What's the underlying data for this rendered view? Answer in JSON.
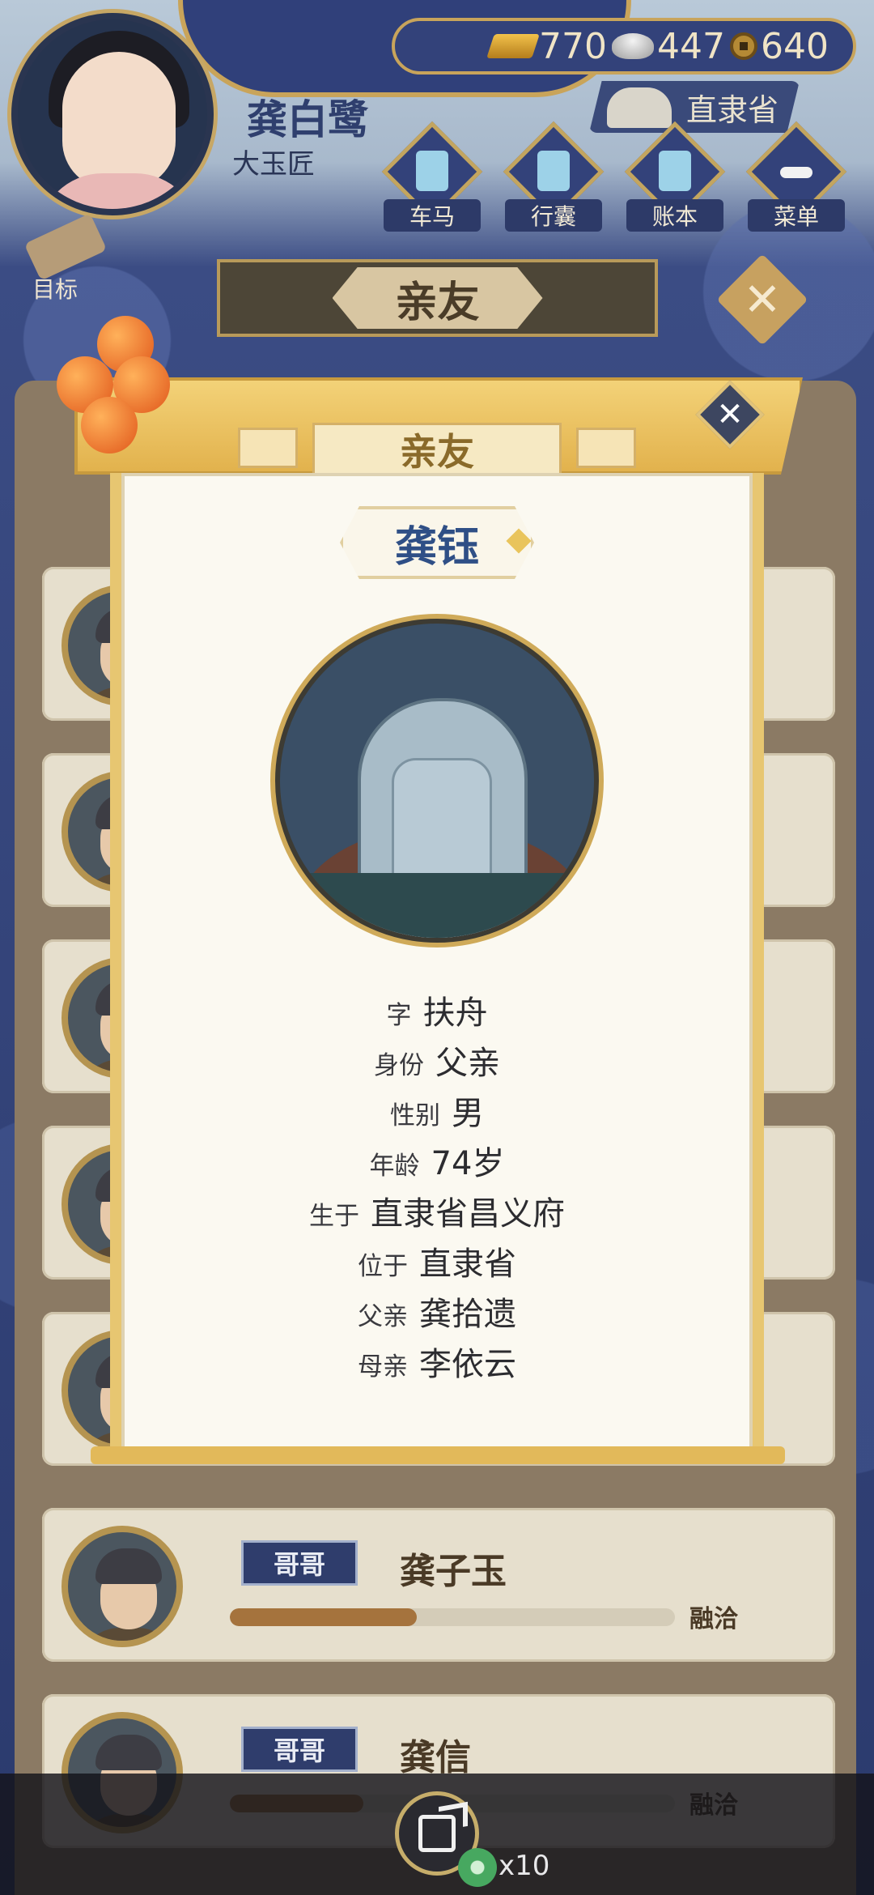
{
  "player": {
    "name": "龚白鹭",
    "title": "大玉匠"
  },
  "currency": {
    "gold": "770",
    "silver": "447",
    "coins": "640"
  },
  "location": "直隶省",
  "menu": [
    {
      "label": "车马",
      "icon": "carriage-icon"
    },
    {
      "label": "行囊",
      "icon": "bag-icon"
    },
    {
      "label": "账本",
      "icon": "ledger-icon"
    },
    {
      "label": "菜单",
      "icon": "menu-dots-icon"
    }
  ],
  "goal_label": "目标",
  "section_title": "亲友",
  "relatives": [
    {
      "relation": "哥哥",
      "name": "龚子玉",
      "affinity_label": "融洽",
      "affinity": 0.42
    },
    {
      "relation": "哥哥",
      "name": "龚信",
      "affinity_label": "融洽",
      "affinity": 0.3
    }
  ],
  "modal": {
    "title": "亲友",
    "person_name": "龚钰",
    "details": [
      {
        "key": "字",
        "value": "扶舟"
      },
      {
        "key": "身份",
        "value": "父亲"
      },
      {
        "key": "性别",
        "value": "男"
      },
      {
        "key": "年龄",
        "value": "74岁"
      },
      {
        "key": "生于",
        "value": "直隶省昌义府"
      },
      {
        "key": "位于",
        "value": "直隶省"
      },
      {
        "key": "父亲",
        "value": "龚拾遗"
      },
      {
        "key": "母亲",
        "value": "李依云"
      }
    ]
  },
  "bottom": {
    "reward_count": "x10"
  },
  "colors": {
    "navy": "#2f3f73",
    "gold": "#e2b24d",
    "paper": "#fbf9f1",
    "name_blue": "#2f4f86"
  }
}
